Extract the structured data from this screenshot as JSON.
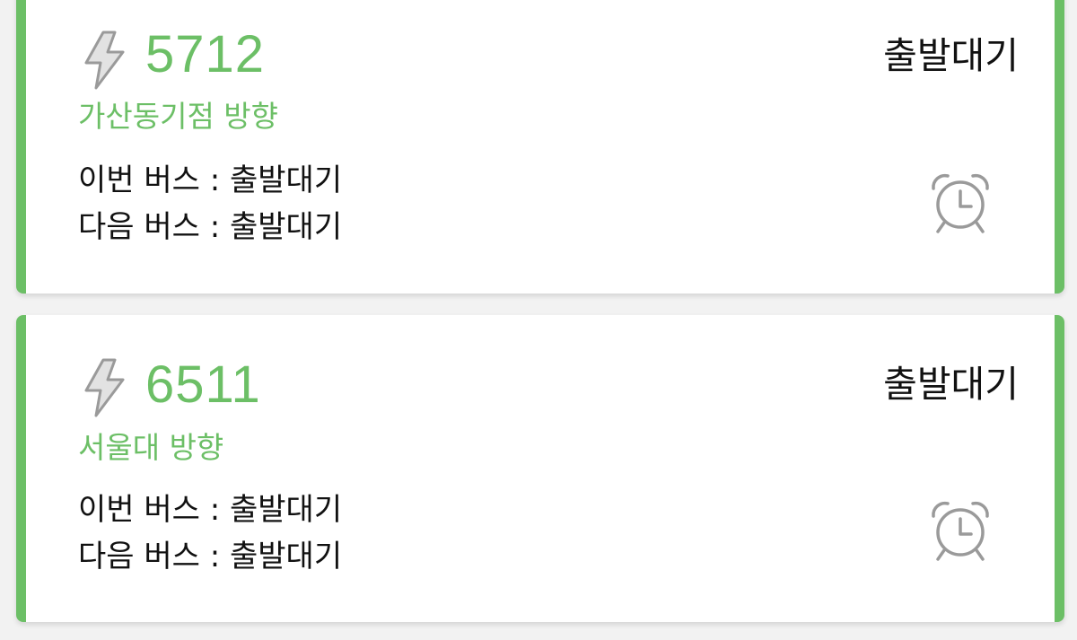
{
  "colors": {
    "accent": "#6cbf66",
    "icon_gray": "#9a9a9a",
    "text": "#111111",
    "card_background": "#ffffff",
    "page_background": "#f2f2f2"
  },
  "bus_cards": [
    {
      "icon": "lightning-bolt-icon",
      "route_number": "5712",
      "direction": "가산동기점 방향",
      "status": "출발대기",
      "this_bus": "이번 버스 : 출발대기",
      "next_bus": "다음 버스 : 출발대기",
      "alarm_icon": "alarm-clock-icon"
    },
    {
      "icon": "lightning-bolt-icon",
      "route_number": "6511",
      "direction": "서울대 방향",
      "status": "출발대기",
      "this_bus": "이번 버스 : 출발대기",
      "next_bus": "다음 버스 : 출발대기",
      "alarm_icon": "alarm-clock-icon"
    }
  ]
}
